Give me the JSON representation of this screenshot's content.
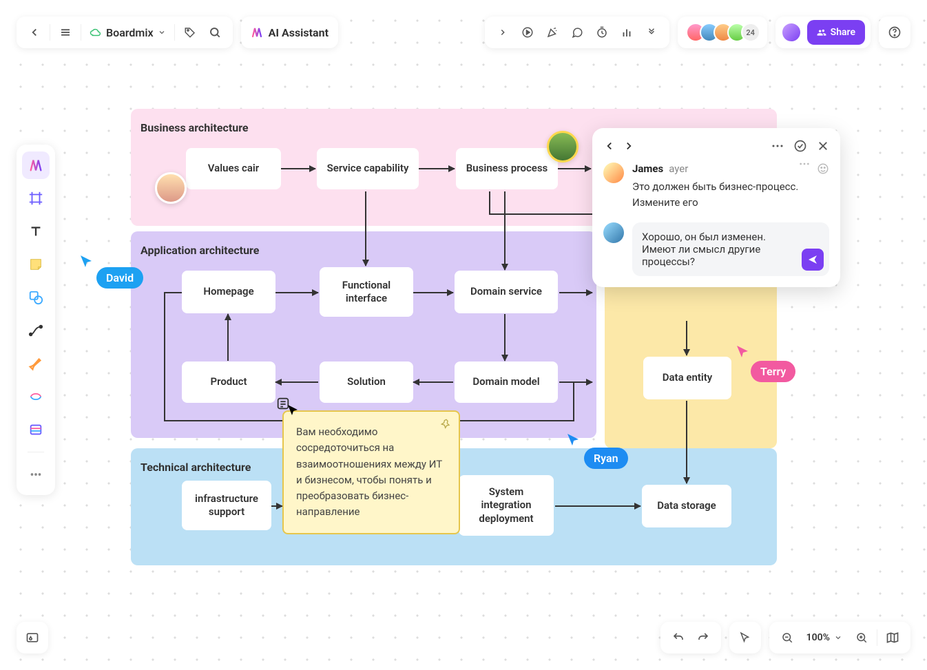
{
  "app": {
    "name": "Boardmix",
    "ai_label": "AI Assistant"
  },
  "header": {
    "share_label": "Share",
    "avatar_extra": "24",
    "zoom": "100%"
  },
  "sections": {
    "business": {
      "title": "Business architecture",
      "nodes": [
        "Values cair",
        "Service capability",
        "Business process"
      ]
    },
    "application": {
      "title": "Application architecture",
      "nodes": [
        "Homepage",
        "Functional interface",
        "Domain service",
        "Product",
        "Solution",
        "Domain model"
      ]
    },
    "data": {
      "title": "",
      "nodes": [
        "Data entity"
      ]
    },
    "technical": {
      "title": "Technical architecture",
      "nodes": [
        "infrastructure support",
        "System integration deployment",
        "Data storage"
      ]
    }
  },
  "cursors": {
    "david": "David",
    "ryan": "Ryan",
    "terry": "Terry"
  },
  "comment": {
    "author": "James",
    "time": "ayer",
    "text": "Это должен быть бизнес-процесс. Измените его",
    "reply": "Хорошо, он был изменен. Имеют ли смысл другие процессы?"
  },
  "sticky": {
    "text": "Вам необходимо сосредоточиться на взаимоотношениях между ИТ и бизнесом, чтобы понять и преобразовать бизнес-направление"
  }
}
